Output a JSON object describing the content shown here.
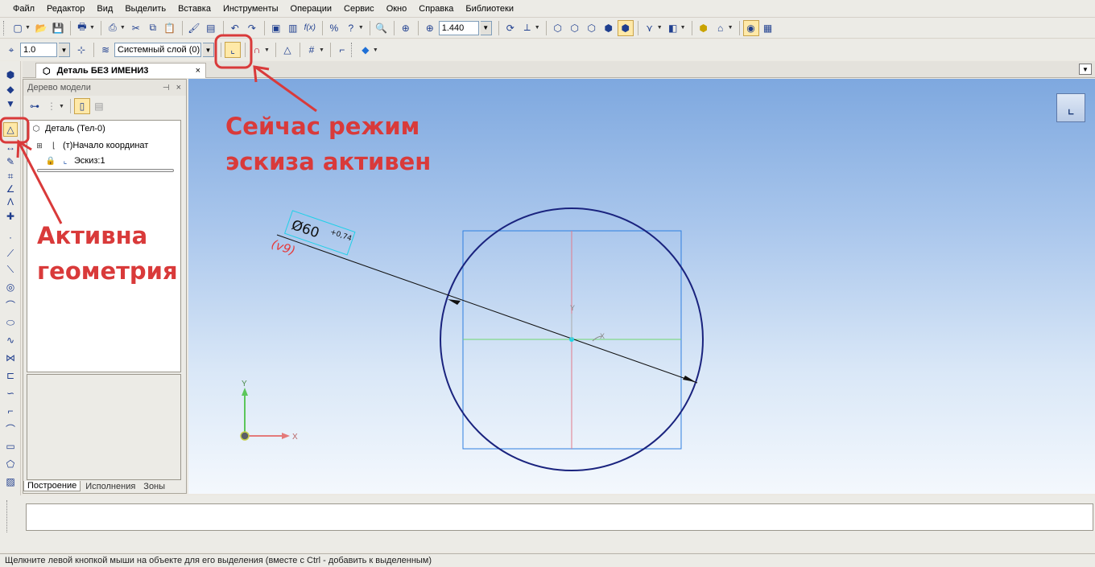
{
  "menu": [
    "Файл",
    "Редактор",
    "Вид",
    "Выделить",
    "Вставка",
    "Инструменты",
    "Операции",
    "Сервис",
    "Окно",
    "Справка",
    "Библиотеки"
  ],
  "toolbar": {
    "zoom_value": "1.440",
    "step_value": "1.0",
    "layer_value": "Системный слой (0)"
  },
  "document_tab": {
    "title": "Деталь БЕЗ ИМЕНИ3",
    "close": "×"
  },
  "tree": {
    "header": "Дерево модели",
    "items": [
      {
        "label": "Деталь (Тел-0)",
        "icon": "part-icon"
      },
      {
        "label": "(т)Начало координат",
        "icon": "origin-icon"
      },
      {
        "label": "Эскиз:1",
        "icon": "sketch-icon"
      }
    ],
    "tabs": [
      "Построение",
      "Исполнения",
      "Зоны"
    ]
  },
  "drawing": {
    "dimension_main": "Ø60",
    "dimension_tolerance": "+0,74",
    "dimension_ref": "(v9)",
    "axis_x": "X",
    "axis_y": "Y"
  },
  "annotations": {
    "sketch_mode": [
      "Сейчас режим",
      "эскиза активен"
    ],
    "geometry": [
      "Активна",
      "геометрия"
    ]
  },
  "status": {
    "hint": "Щелкните левой кнопкой мыши на объекте для его выделения (вместе с Ctrl - добавить к выделенным)"
  },
  "colors": {
    "annotation": "#d93a3a",
    "circle": "#1a237e",
    "active_button": "#ffe9a8"
  }
}
